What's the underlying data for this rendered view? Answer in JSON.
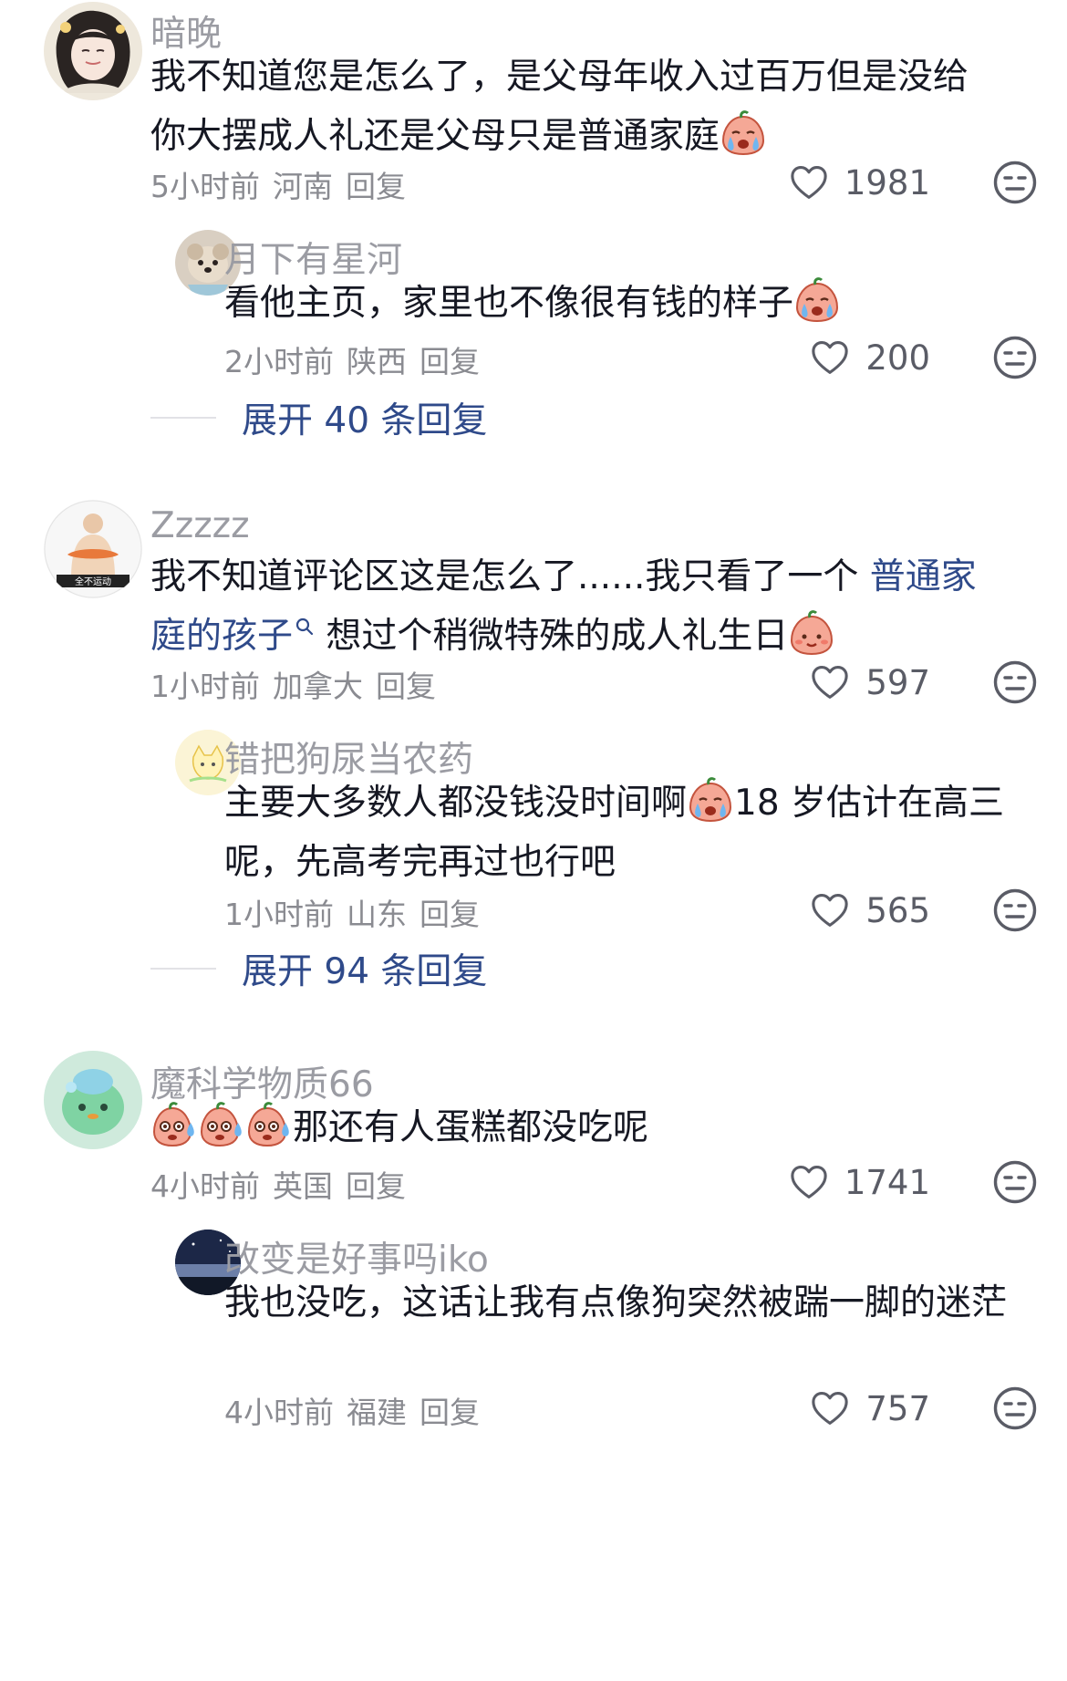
{
  "comments": [
    {
      "username": "暗晚",
      "text": "我不知道您是怎么了，是父母年收入过百万但是没给你大摆成人礼还是父母只是普通家庭",
      "time": "5小时前",
      "location": "河南",
      "reply_label": "回复",
      "likes": "1981",
      "reply": {
        "username": "月下有星河",
        "text": "看他主页，家里也不像很有钱的样子",
        "time": "2小时前",
        "location": "陕西",
        "reply_label": "回复",
        "likes": "200"
      },
      "expand_label": "展开 40 条回复"
    },
    {
      "username": "Zzzzz",
      "text_before": "我不知道评论区这是怎么了......我只看了一个 ",
      "text_link": "普通家庭的孩子",
      "text_after": " 想过个稍微特殊的成人礼生日",
      "time": "1小时前",
      "location": "加拿大",
      "reply_label": "回复",
      "likes": "597",
      "avatar_text": "全不运动",
      "reply": {
        "username": "错把狗尿当农药",
        "text_before": "主要大多数人都没钱没时间啊",
        "text_after": "18 岁估计在高三呢，先高考完再过也行吧",
        "time": "1小时前",
        "location": "山东",
        "reply_label": "回复",
        "likes": "565"
      },
      "expand_label": "展开 94 条回复"
    },
    {
      "username": "魔科学物质66",
      "text": "那还有人蛋糕都没吃呢",
      "time": "4小时前",
      "location": "英国",
      "reply_label": "回复",
      "likes": "1741",
      "reply": {
        "username": "改变是好事吗iko",
        "text": "我也没吃，这话让我有点像狗突然被踹一脚的迷茫",
        "time": "4小时前",
        "location": "福建",
        "reply_label": "回复",
        "likes": "757"
      }
    }
  ],
  "colors": {
    "username": "#9b9ca3",
    "text": "#161823",
    "link": "#2f4a8a",
    "meta": "#8a8b91"
  },
  "icons": [
    "heart-icon",
    "dislike-face-icon",
    "search-small-icon",
    "crying-emoji",
    "sweat-emoji",
    "smile-emoji"
  ]
}
